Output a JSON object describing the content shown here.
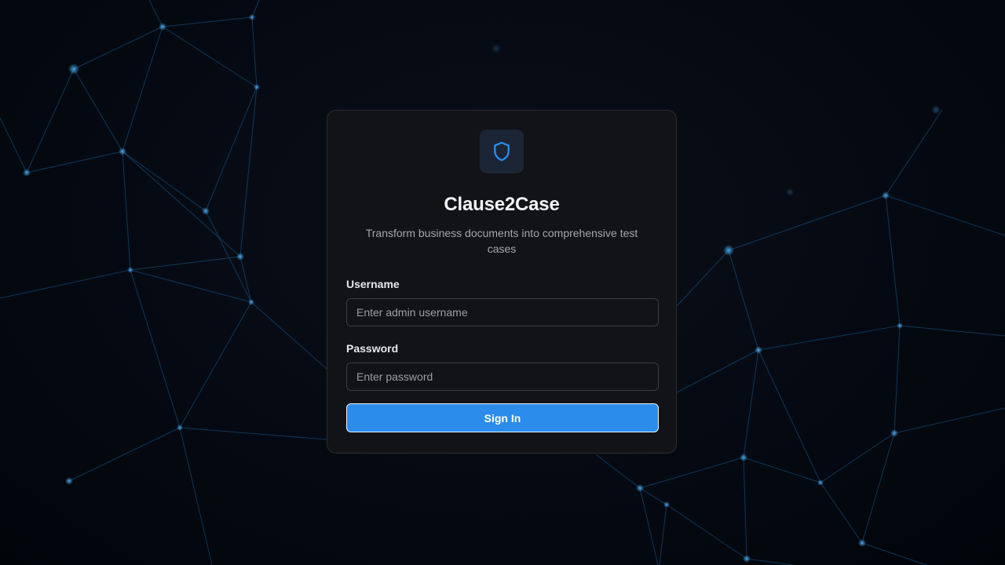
{
  "app": {
    "title": "Clause2Case",
    "subtitle": "Transform business documents into comprehensive test cases",
    "logo_icon": "shield-icon"
  },
  "form": {
    "username_label": "Username",
    "username_placeholder": "Enter admin username",
    "username_value": "",
    "password_label": "Password",
    "password_placeholder": "Enter password",
    "password_value": "",
    "submit_label": "Sign In"
  },
  "colors": {
    "accent": "#2b8cec",
    "background": "#02060c",
    "card": "#121316",
    "network_lines": "#1d6fb0"
  }
}
